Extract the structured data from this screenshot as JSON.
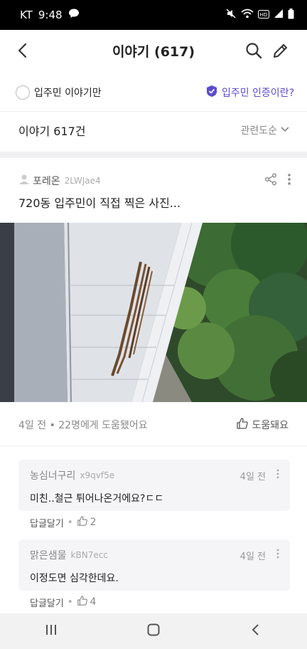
{
  "status": {
    "carrier": "KT",
    "time": "9:48"
  },
  "header": {
    "title": "이야기 (617)"
  },
  "filter": {
    "resident_only_label": "입주민 이야기만",
    "cert_link": "입주민 인증이란?"
  },
  "list": {
    "count_label": "이야기 617건",
    "sort_label": "관련도순"
  },
  "post": {
    "author": "포레온",
    "user_id": "2LWJae4",
    "title": "720동 입주민이 직접 찍은 사진...",
    "meta": "4일 전 • 22명에게 도움됐어요",
    "help_label": "도움돼요"
  },
  "comments": [
    {
      "author": "농심너구리",
      "user_id": "x9qvf5e",
      "time": "4일 전",
      "text": "미친..철근 튀어나온거에요?ㄷㄷ",
      "reply_label": "답글달기",
      "likes": "2"
    },
    {
      "author": "맑은샘물",
      "user_id": "kBN7ecc",
      "time": "4일 전",
      "text": "이정도면 심각한데요.",
      "reply_label": "답글달기",
      "likes": "4"
    }
  ],
  "colors": {
    "accent": "#5a4bd1"
  }
}
